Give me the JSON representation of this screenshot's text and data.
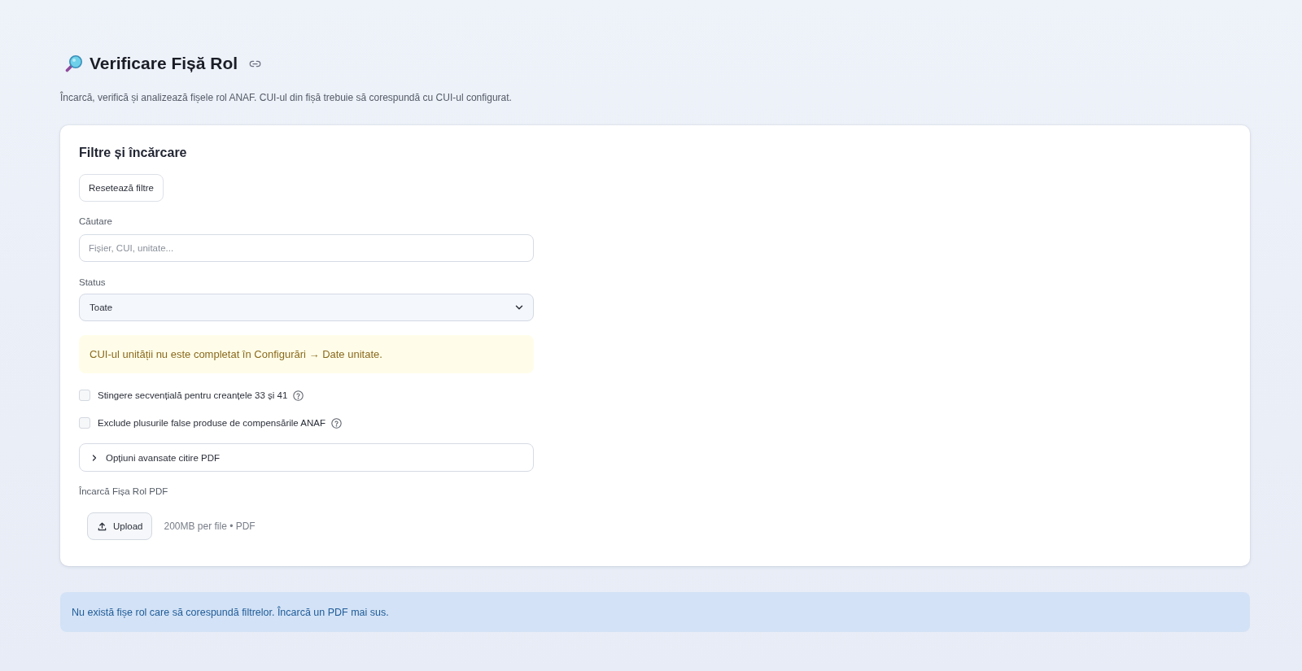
{
  "page": {
    "title": "Verificare Fișă Rol",
    "subtitle": "Încarcă, verifică și analizează fișele rol ANAF. CUI-ul din fișă trebuie să corespundă cu CUI-ul configurat."
  },
  "filters_card": {
    "heading": "Filtre și încărcare",
    "reset_button": "Resetează filtre",
    "search": {
      "label": "Căutare",
      "placeholder": "Fișier, CUI, unitate..."
    },
    "status": {
      "label": "Status",
      "value": "Toate"
    },
    "warning": "CUI-ul unității nu este completat în Configurări → Date unitate.",
    "options": [
      {
        "label": "Stingere secvențială pentru creanțele 33 și 41",
        "checked": false,
        "help": true
      },
      {
        "label": "Exclude plusurile false produse de compensările ANAF",
        "checked": false,
        "help": true
      }
    ],
    "advanced": {
      "label": "Opțiuni avansate citire PDF",
      "expanded": false
    },
    "upload": {
      "label": "Încarcă Fișa Rol PDF",
      "button": "Upload",
      "hint": "200MB per file • PDF"
    }
  },
  "info_message": "Nu există fișe rol care să corespundă filtrelor. Încarcă un PDF mai sus."
}
